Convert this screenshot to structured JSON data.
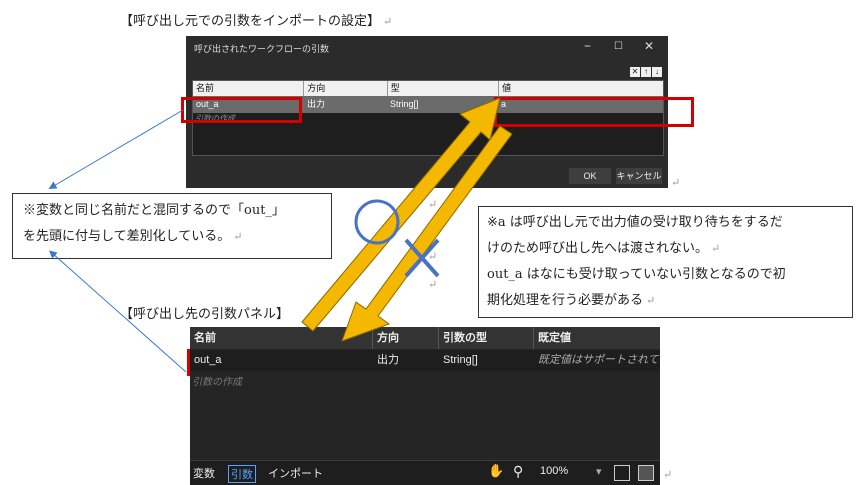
{
  "caption_top": "【呼び出し元での引数をインポートの設定】",
  "caption_mid": "【呼び出し先の引数パネル】",
  "dialog": {
    "title": "呼び出されたワークフローの引数",
    "win_min": "−",
    "win_max": "☐",
    "win_close": "✕",
    "tool_delete": "✕",
    "tool_up": "↑",
    "tool_down": "↓",
    "columns": [
      "名前",
      "方向",
      "型",
      "値"
    ],
    "row": {
      "name": "out_a",
      "direction": "出力",
      "type": "String[]",
      "value": "a"
    },
    "add_placeholder": "引数の作成",
    "ok_label": "OK",
    "cancel_label": "キャンセル"
  },
  "note_left": {
    "line1": "※変数と同じ名前だと混同するので「out_」",
    "line2": "を先頭に付与して差別化している。"
  },
  "note_right": {
    "line1": "※a は呼び出し元で出力値の受け取り待ちをするだ",
    "line2": "けのため呼び出し先へは渡されない。",
    "line3": "out_a はなにも受け取っていない引数となるので初",
    "line4": "期化処理を行う必要がある"
  },
  "panel": {
    "columns": [
      "名前",
      "方向",
      "引数の型",
      "既定値"
    ],
    "row": {
      "name": "out_a",
      "direction": "出力",
      "type": "String[]",
      "default": "既定値はサポートされていま"
    },
    "add_placeholder": "引数の作成",
    "tab_variables": "変数",
    "tab_arguments": "引数",
    "tab_imports": "インポート",
    "hand_icon": "✋",
    "search_icon": "⚲",
    "zoom": "100%",
    "zoom_caret": "▾"
  },
  "return_mark": "↵",
  "colors": {
    "red": "#d40000",
    "arrow": "#f5b800",
    "blue": "#4a72c4"
  }
}
